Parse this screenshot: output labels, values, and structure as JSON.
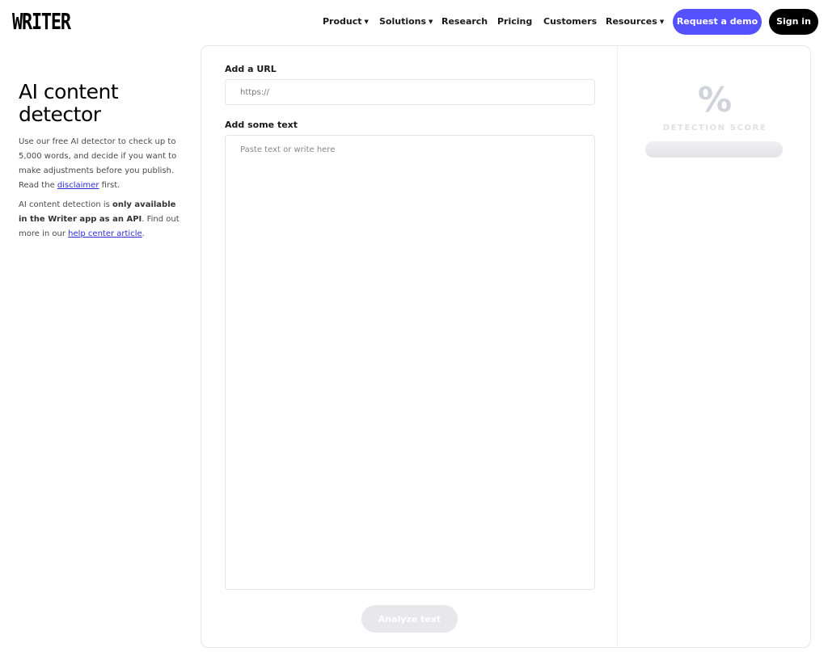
{
  "header": {
    "logo": "WRITER",
    "nav": [
      {
        "label": "Product",
        "caret": true
      },
      {
        "label": "Solutions",
        "caret": true
      },
      {
        "label": "Research",
        "caret": false
      },
      {
        "label": "Pricing",
        "caret": false
      },
      {
        "label": "Customers",
        "caret": false
      },
      {
        "label": "Resources",
        "caret": true
      }
    ],
    "demo_label": "Request a demo",
    "signin_label": "Sign in",
    "colors": {
      "accent": "#5551ff",
      "dark": "#000000"
    }
  },
  "intro": {
    "title": "AI content detector",
    "p1_before": "Use our free AI detector to check up to 5,000 words, and decide if you want to make adjustments before you publish. Read the ",
    "p1_link": "disclaimer",
    "p1_after": " first.",
    "p2_before": "AI content detection is ",
    "p2_bold": "only available in the Writer app as an API",
    "p2_middle": ". Find out more in our ",
    "p2_link": "help center article",
    "p2_after": "."
  },
  "form": {
    "url_label": "Add a URL",
    "url_value": "",
    "url_placeholder": "https://",
    "text_label": "Add some text",
    "text_value": "",
    "text_placeholder": "Paste text or write here",
    "analyze_label": "Analyze text"
  },
  "score": {
    "symbol": "%",
    "label": "DETECTION SCORE",
    "value": null,
    "fill_fraction": 0
  }
}
